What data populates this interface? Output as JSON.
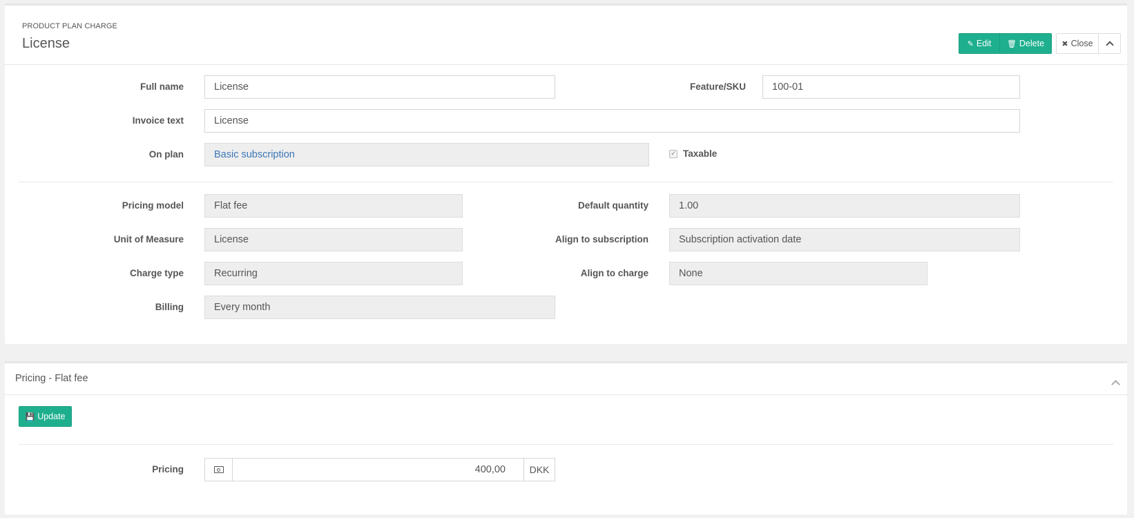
{
  "header": {
    "breadcrumb": "PRODUCT PLAN CHARGE",
    "title": "License",
    "buttons": {
      "edit": "Edit",
      "delete": "Delete",
      "close": "Close"
    }
  },
  "form": {
    "full_name": {
      "label": "Full name",
      "value": "License"
    },
    "feature_sku": {
      "label": "Feature/SKU",
      "value": "100-01"
    },
    "invoice_text": {
      "label": "Invoice text",
      "value": "License"
    },
    "on_plan": {
      "label": "On plan",
      "value": "Basic subscription"
    },
    "taxable": {
      "label": "Taxable",
      "checked": true
    },
    "pricing_model": {
      "label": "Pricing model",
      "value": "Flat fee"
    },
    "default_quantity": {
      "label": "Default quantity",
      "value": "1.00"
    },
    "unit_of_measure": {
      "label": "Unit of Measure",
      "value": "License"
    },
    "align_to_subscription": {
      "label": "Align to subscription",
      "value": "Subscription activation date"
    },
    "charge_type": {
      "label": "Charge type",
      "value": "Recurring"
    },
    "align_to_charge": {
      "label": "Align to charge",
      "value": "None"
    },
    "billing": {
      "label": "Billing",
      "value": "Every month"
    }
  },
  "pricing_panel": {
    "title": "Pricing - Flat fee",
    "update_button": "Update",
    "pricing": {
      "label": "Pricing",
      "value": "400,00",
      "currency": "DKK"
    }
  },
  "colors": {
    "accent": "#1eaf8e",
    "link": "#3a76b5",
    "readonly_bg": "#eeeeee",
    "page_bg": "#f1f1f1"
  }
}
